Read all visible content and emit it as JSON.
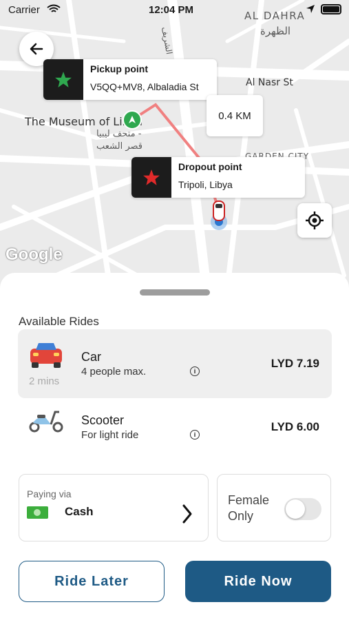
{
  "status_bar": {
    "carrier": "Carrier",
    "time": "12:04 PM"
  },
  "map": {
    "labels": {
      "al_dahra": "AL DAHRA",
      "al_dahra_ar": "الظهرة",
      "al_nasr": "Al Nasr St",
      "museum": "The Museum of Libya",
      "museum_ar_1": "متحف ليبيا -",
      "museum_ar_2": "قصر الشعب",
      "garden_city": "GARDEN CITY",
      "street_ar": "الشريف"
    },
    "pickup": {
      "title": "Pickup point",
      "address": "V5QQ+MV8, Albaladia St"
    },
    "dropoff": {
      "title": "Dropout point",
      "address": "Tripoli, Libya"
    },
    "distance": "0.4 KM",
    "attribution": "Google"
  },
  "sheet": {
    "section_title": "Available Rides",
    "rides": [
      {
        "name": "Car",
        "subtitle": "4 people max.",
        "eta": "2 mins",
        "price": "LYD 7.19",
        "icon": "car-icon"
      },
      {
        "name": "Scooter",
        "subtitle": "For light ride",
        "price": "LYD 6.00",
        "icon": "scooter-icon"
      }
    ],
    "payment": {
      "label": "Paying via",
      "method": "Cash"
    },
    "female_only": {
      "label": "Female\nOnly",
      "enabled": false
    },
    "buttons": {
      "later": "Ride Later",
      "now": "Ride Now"
    }
  },
  "colors": {
    "primary": "#1e5a85",
    "route": "#f08080",
    "star_green": "#2fa84f",
    "star_red": "#e12a2a"
  }
}
